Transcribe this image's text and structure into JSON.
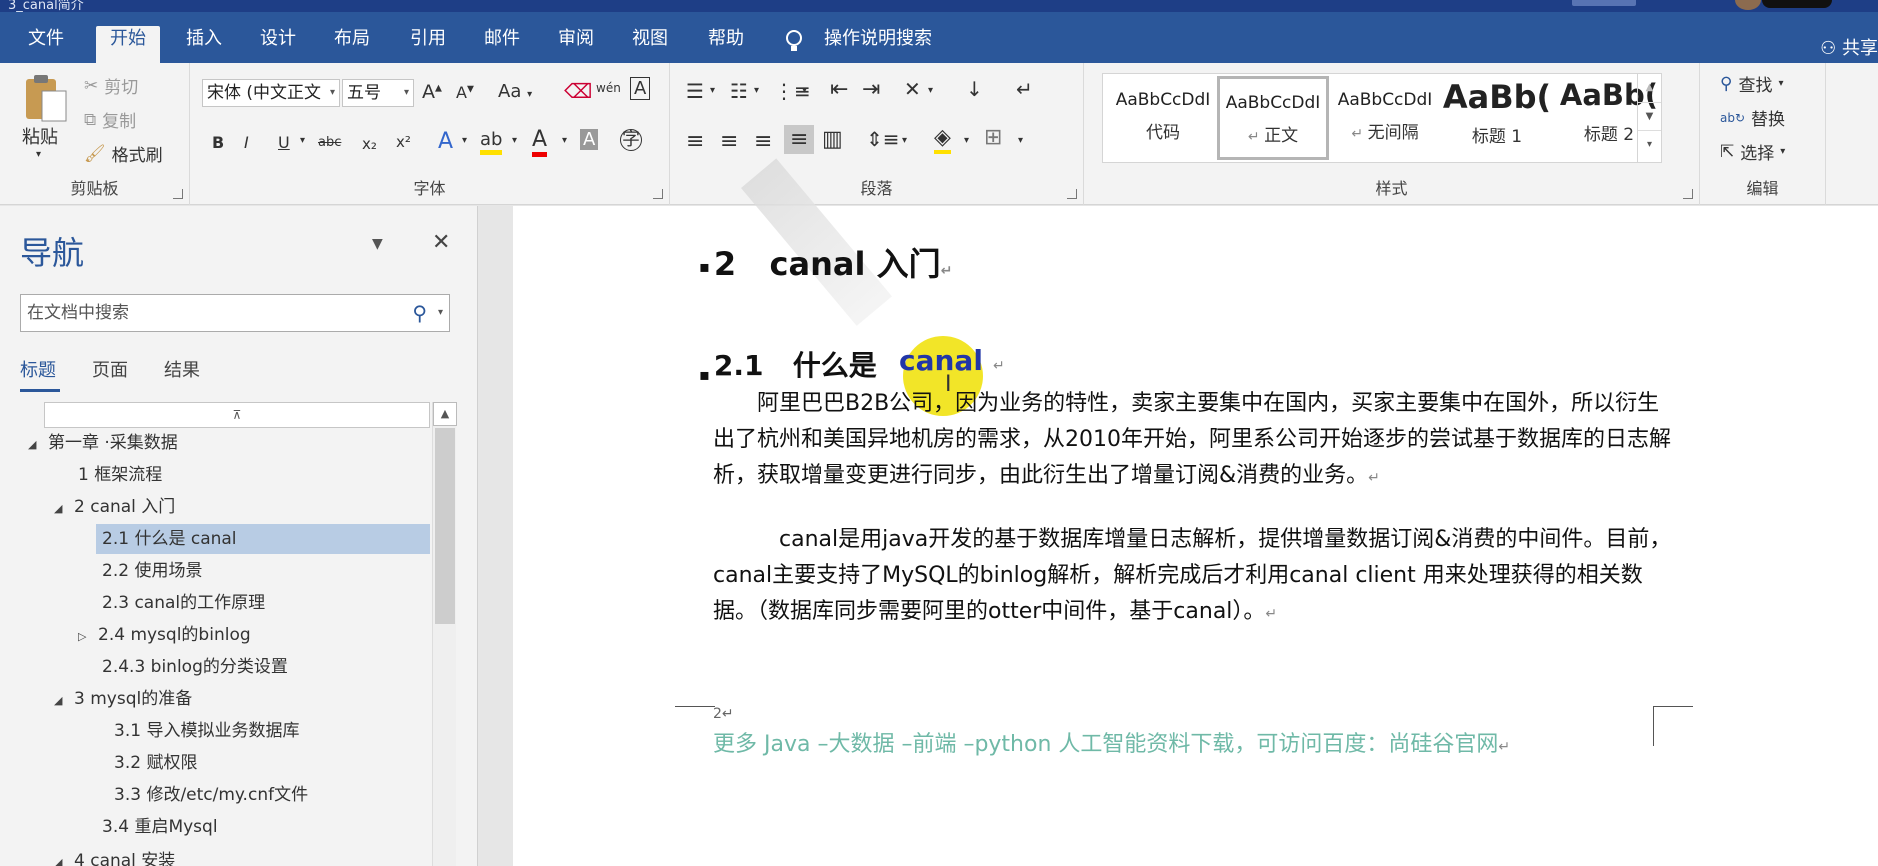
{
  "window": {
    "title": "3_canal简介"
  },
  "tabs": [
    "文件",
    "开始",
    "插入",
    "设计",
    "布局",
    "引用",
    "邮件",
    "审阅",
    "视图",
    "帮助"
  ],
  "tell_me": "操作说明搜索",
  "share": "共享",
  "clipboard": {
    "paste": "粘贴",
    "cut": "剪切",
    "copy": "复制",
    "format_painter": "格式刷",
    "label": "剪贴板"
  },
  "font": {
    "name": "宋体 (中文正文",
    "size": "五号",
    "grow": "A",
    "shrink": "A",
    "case": "Aa",
    "phonetic": "wén",
    "label": "字体"
  },
  "paragraph": {
    "label": "段落"
  },
  "styles": {
    "label": "样式",
    "items": [
      {
        "sample": "AaBbCcDdI",
        "name": "代码"
      },
      {
        "sample": "AaBbCcDdI",
        "name": "正文"
      },
      {
        "sample": "AaBbCcDdI",
        "name": "无间隔"
      },
      {
        "sample": "AaBb(",
        "name": "标题 1"
      },
      {
        "sample": "AaBb(",
        "name": "标题 2"
      }
    ]
  },
  "editing": {
    "find": "查找",
    "replace": "替换",
    "select": "选择",
    "label": "编辑"
  },
  "nav": {
    "title": "导航",
    "search_placeholder": "在文档中搜索",
    "tabs": [
      "标题",
      "页面",
      "结果"
    ],
    "items": [
      {
        "text": "第一章 ·采集数据"
      },
      {
        "text": "1  框架流程"
      },
      {
        "text": "2  canal 入门"
      },
      {
        "text": "2.1  什么是 canal"
      },
      {
        "text": "2.2 使用场景"
      },
      {
        "text": "2.3 canal的工作原理"
      },
      {
        "text": "2.4  mysql的binlog"
      },
      {
        "text": "2.4.3 binlog的分类设置"
      },
      {
        "text": "3  mysql的准备"
      },
      {
        "text": "3.1 导入模拟业务数据库"
      },
      {
        "text": "3.2 赋权限"
      },
      {
        "text": "3.3 修改/etc/my.cnf文件"
      },
      {
        "text": "3.4 重启Mysql"
      },
      {
        "text": "4 canal 安装"
      }
    ]
  },
  "document": {
    "h1_num": "2",
    "h1_text": "canal  入门",
    "h2_num": "2.1",
    "h2_text": "什么是",
    "h2_word": "canal",
    "para1": "阿里巴巴B2B公司，因为业务的特性，卖家主要集中在国内，买家主要集中在国外，所以衍生出了杭州和美国异地机房的需求，从2010年开始，阿里系公司开始逐步的尝试基于数据库的日志解析，获取增量变更进行同步，由此衍生出了增量订阅&消费的业务。",
    "para2": "canal是用java开发的基于数据库增量日志解析，提供增量数据订阅&消费的中间件。目前，canal主要支持了MySQL的binlog解析，解析完成后才利用canal client 用来处理获得的相关数据。（数据库同步需要阿里的otter中间件，基于canal）。",
    "page_number": "2",
    "footer": "更多 Java –大数据 –前端 –python 人工智能资料下载，可访问百度：尚硅谷官网"
  }
}
